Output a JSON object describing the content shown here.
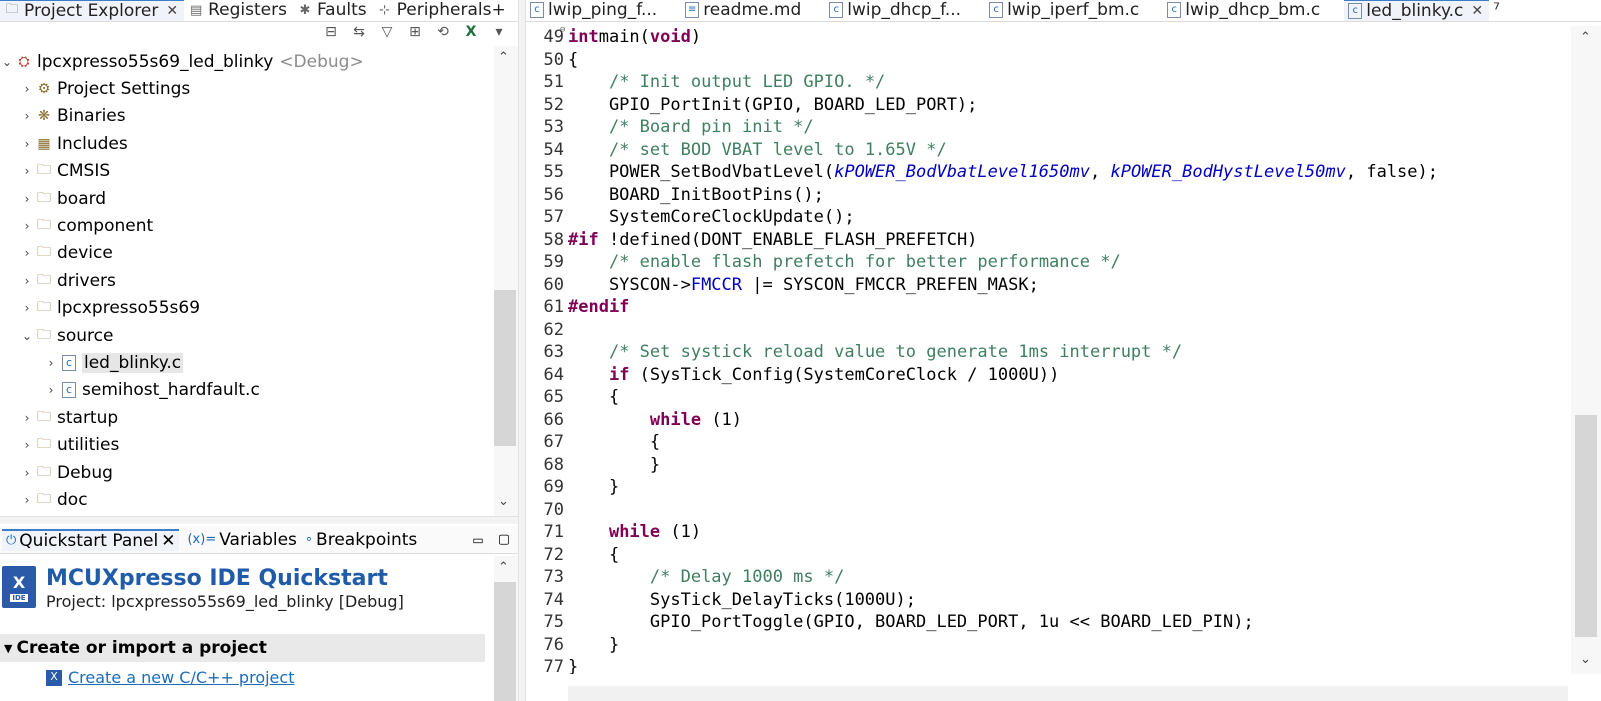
{
  "left_tabs": [
    {
      "label": "Project Explorer",
      "active": true,
      "icon": "folder-icon",
      "closable": true
    },
    {
      "label": "Registers",
      "active": false,
      "icon": "registers-icon"
    },
    {
      "label": "Faults",
      "active": false,
      "icon": "bug-icon"
    },
    {
      "label": "Peripherals+",
      "active": false,
      "icon": "peripherals-icon"
    }
  ],
  "tree": {
    "project_name": "lpcxpresso55s69_led_blinky",
    "project_config": "<Debug>",
    "items": [
      {
        "label": "Project Settings",
        "icon": "settings-icon",
        "level": 1,
        "expanded": false
      },
      {
        "label": "Binaries",
        "icon": "binaries-icon",
        "level": 1,
        "expanded": false
      },
      {
        "label": "Includes",
        "icon": "includes-icon",
        "level": 1,
        "expanded": false
      },
      {
        "label": "CMSIS",
        "icon": "folder-icon",
        "level": 1,
        "expanded": false
      },
      {
        "label": "board",
        "icon": "folder-icon",
        "level": 1,
        "expanded": false
      },
      {
        "label": "component",
        "icon": "folder-icon",
        "level": 1,
        "expanded": false
      },
      {
        "label": "device",
        "icon": "folder-icon",
        "level": 1,
        "expanded": false
      },
      {
        "label": "drivers",
        "icon": "folder-icon",
        "level": 1,
        "expanded": false
      },
      {
        "label": "lpcxpresso55s69",
        "icon": "folder-icon",
        "level": 1,
        "expanded": false
      },
      {
        "label": "source",
        "icon": "folder-icon",
        "level": 1,
        "expanded": true
      },
      {
        "label": "led_blinky.c",
        "icon": "c-file-icon",
        "level": 2,
        "expanded": false,
        "selected": true
      },
      {
        "label": "semihost_hardfault.c",
        "icon": "c-file-icon",
        "level": 2,
        "expanded": false
      },
      {
        "label": "startup",
        "icon": "folder-icon",
        "level": 1,
        "expanded": false
      },
      {
        "label": "utilities",
        "icon": "folder-icon",
        "level": 1,
        "expanded": false
      },
      {
        "label": "Debug",
        "icon": "folder-icon",
        "level": 1,
        "expanded": false
      },
      {
        "label": "doc",
        "icon": "folder-icon",
        "level": 1,
        "expanded": false
      }
    ]
  },
  "quick_tabs": [
    {
      "label": "Quickstart Panel",
      "active": true,
      "icon": "power-icon"
    },
    {
      "label": "Variables",
      "active": false,
      "icon": "variables-icon"
    },
    {
      "label": "Breakpoints",
      "active": false,
      "icon": "breakpoint-icon"
    }
  ],
  "quickstart": {
    "title": "MCUXpresso IDE Quickstart",
    "project": "Project: lpcxpresso55s69_led_blinky [Debug]",
    "logo_text": "X",
    "logo_sub": "IDE",
    "section": "Create or import a project",
    "link": "Create a new C/C++ project"
  },
  "editor_tabs": [
    {
      "label": "lwip_ping_f...",
      "active": false
    },
    {
      "label": "readme.md",
      "active": false
    },
    {
      "label": "lwip_dhcp_f...",
      "active": false
    },
    {
      "label": "lwip_iperf_bm.c",
      "active": false
    },
    {
      "label": "lwip_dhcp_bm.c",
      "active": false
    },
    {
      "label": "led_blinky.c",
      "active": true
    },
    {
      "label": "⁷",
      "active": false
    }
  ],
  "code_lines": [
    {
      "n": "49",
      "fold": "⊖",
      "parts": [
        [
          "kw",
          "int"
        ],
        [
          "",
          "main("
        ],
        [
          "kw",
          "void"
        ],
        [
          "",
          ")"
        ]
      ]
    },
    {
      "n": "50",
      "parts": [
        [
          "",
          "{"
        ]
      ]
    },
    {
      "n": "51",
      "parts": [
        [
          "",
          "    "
        ],
        [
          "cm",
          "/* Init output LED GPIO. */"
        ]
      ]
    },
    {
      "n": "52",
      "parts": [
        [
          "",
          "    GPIO_PortInit(GPIO, BOARD_LED_PORT);"
        ]
      ]
    },
    {
      "n": "53",
      "parts": [
        [
          "",
          "    "
        ],
        [
          "cm",
          "/* Board pin init */"
        ]
      ]
    },
    {
      "n": "54",
      "parts": [
        [
          "",
          "    "
        ],
        [
          "cm",
          "/* set BOD VBAT level to 1.65V */"
        ]
      ]
    },
    {
      "n": "55",
      "parts": [
        [
          "",
          "    POWER_SetBodVbatLevel("
        ],
        [
          "it",
          "kPOWER_BodVbatLevel1650mv"
        ],
        [
          "",
          ", "
        ],
        [
          "it",
          "kPOWER_BodHystLevel50mv"
        ],
        [
          "",
          ", false);"
        ]
      ]
    },
    {
      "n": "56",
      "parts": [
        [
          "",
          "    BOARD_InitBootPins();"
        ]
      ]
    },
    {
      "n": "57",
      "parts": [
        [
          "",
          "    SystemCoreClockUpdate();"
        ]
      ]
    },
    {
      "n": "58",
      "parts": [
        [
          "pp",
          "#if"
        ],
        [
          "",
          " !defined(DONT_ENABLE_FLASH_PREFETCH)"
        ]
      ]
    },
    {
      "n": "59",
      "parts": [
        [
          "",
          "    "
        ],
        [
          "cm",
          "/* enable flash prefetch for better performance */"
        ]
      ]
    },
    {
      "n": "60",
      "parts": [
        [
          "",
          "    SYSCON->"
        ],
        [
          "fld",
          "FMCCR"
        ],
        [
          "",
          " |= SYSCON_FMCCR_PREFEN_MASK;"
        ]
      ]
    },
    {
      "n": "61",
      "parts": [
        [
          "pp",
          "#endif"
        ]
      ]
    },
    {
      "n": "62",
      "parts": [
        [
          "",
          ""
        ]
      ]
    },
    {
      "n": "63",
      "parts": [
        [
          "",
          "    "
        ],
        [
          "cm",
          "/* Set systick reload value to generate 1ms interrupt */"
        ]
      ]
    },
    {
      "n": "64",
      "parts": [
        [
          "",
          "    "
        ],
        [
          "kw",
          "if"
        ],
        [
          "",
          " (SysTick_Config(SystemCoreClock / 1000U))"
        ]
      ]
    },
    {
      "n": "65",
      "parts": [
        [
          "",
          "    {"
        ]
      ]
    },
    {
      "n": "66",
      "parts": [
        [
          "",
          "        "
        ],
        [
          "kw",
          "while"
        ],
        [
          "",
          " (1)"
        ]
      ]
    },
    {
      "n": "67",
      "parts": [
        [
          "",
          "        {"
        ]
      ]
    },
    {
      "n": "68",
      "parts": [
        [
          "",
          "        }"
        ]
      ]
    },
    {
      "n": "69",
      "parts": [
        [
          "",
          "    }"
        ]
      ]
    },
    {
      "n": "70",
      "parts": [
        [
          "",
          ""
        ]
      ]
    },
    {
      "n": "71",
      "parts": [
        [
          "",
          "    "
        ],
        [
          "kw",
          "while"
        ],
        [
          "",
          " (1)"
        ]
      ]
    },
    {
      "n": "72",
      "parts": [
        [
          "",
          "    {"
        ]
      ]
    },
    {
      "n": "73",
      "parts": [
        [
          "",
          "        "
        ],
        [
          "cm",
          "/* Delay 1000 ms */"
        ]
      ]
    },
    {
      "n": "74",
      "parts": [
        [
          "",
          "        SysTick_DelayTicks(1000U);"
        ]
      ]
    },
    {
      "n": "75",
      "parts": [
        [
          "",
          "        GPIO_PortToggle(GPIO, BOARD_LED_PORT, 1u << BOARD_LED_PIN);"
        ]
      ]
    },
    {
      "n": "76",
      "parts": [
        [
          "",
          "    }"
        ]
      ]
    },
    {
      "n": "77",
      "parts": [
        [
          "",
          "}"
        ]
      ]
    }
  ]
}
